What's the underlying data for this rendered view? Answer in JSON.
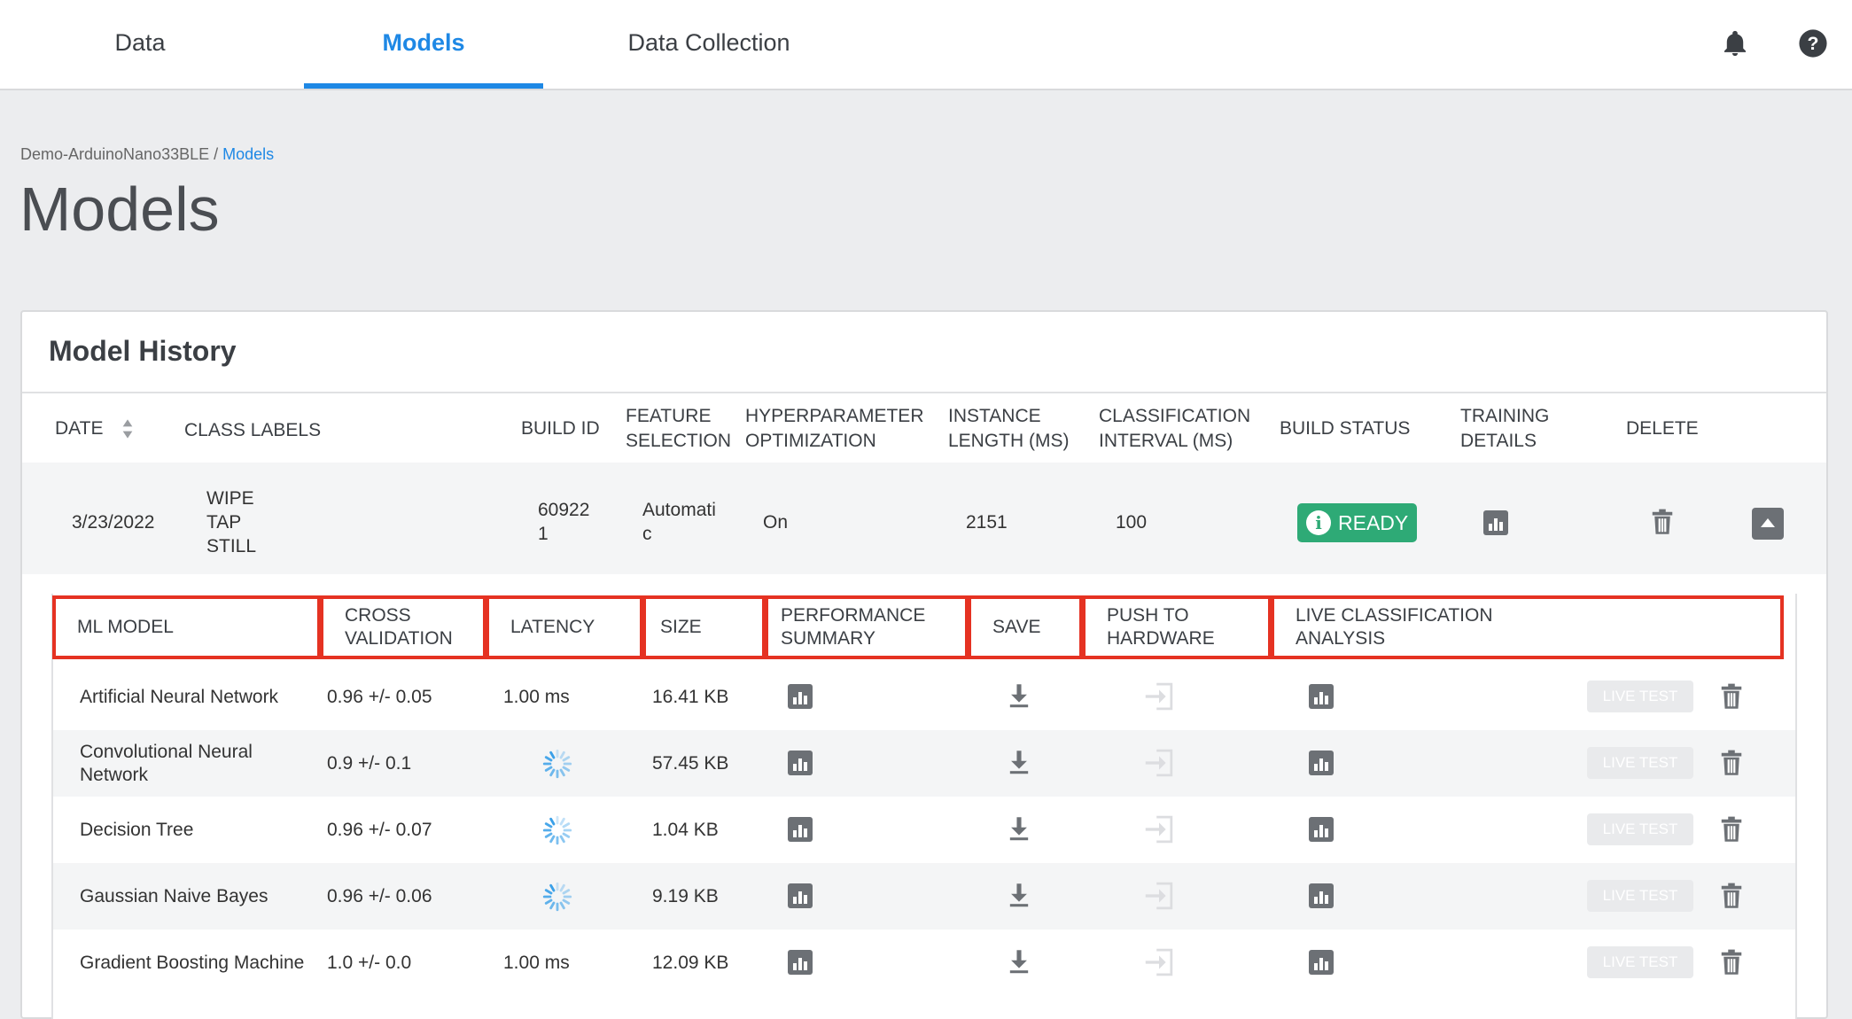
{
  "nav": {
    "tabs": [
      {
        "label": "Data"
      },
      {
        "label": "Models"
      },
      {
        "label": "Data Collection"
      }
    ],
    "active_tab": "Models",
    "icons": [
      "bell-icon",
      "help-icon"
    ]
  },
  "breadcrumb": {
    "project": "Demo-ArduinoNano33BLE",
    "separator": " / ",
    "current": "Models"
  },
  "page_title": "Models",
  "model_history": {
    "title": "Model History",
    "headers": {
      "date": "DATE",
      "class_labels": "CLASS LABELS",
      "build_id": "BUILD ID",
      "feature_selection_1": "FEATURE",
      "feature_selection_2": "SELECTION",
      "hyperparameter_1": "HYPERPARAMETER",
      "hyperparameter_2": "OPTIMIZATION",
      "instance_length_1": "INSTANCE",
      "instance_length_2": "LENGTH (MS)",
      "classification_interval_1": "CLASSIFICATION",
      "classification_interval_2": "INTERVAL (MS)",
      "build_status": "BUILD STATUS",
      "training_details_1": "TRAINING",
      "training_details_2": "DETAILS",
      "delete": "DELETE"
    },
    "build": {
      "date": "3/23/2022",
      "labels": [
        "WIPE",
        "TAP",
        "STILL"
      ],
      "build_id_1": "60922",
      "build_id_2": "1",
      "feature_selection_1": "Automati",
      "feature_selection_2": "c",
      "hyperparameter_optimization": "On",
      "instance_length": "2151",
      "classification_interval": "100",
      "status": "READY",
      "status_color": "#2eaa76"
    },
    "sub_headers": {
      "ml_model": "ML MODEL",
      "cross_validation_1": "CROSS",
      "cross_validation_2": "VALIDATION",
      "latency": "LATENCY",
      "size": "SIZE",
      "performance_1": "PERFORMANCE",
      "performance_2": "SUMMARY",
      "save": "SAVE",
      "push_1": "PUSH TO",
      "push_2": "HARDWARE",
      "live_1": "LIVE CLASSIFICATION",
      "live_2": "ANALYSIS"
    },
    "live_test_label": "LIVE TEST",
    "models": [
      {
        "name_1": "Artificial Neural Network",
        "name_2": "",
        "cv": "0.96 +/- 0.05",
        "latency": "1.00 ms",
        "loading": false,
        "size": "16.41 KB"
      },
      {
        "name_1": "Convolutional Neural",
        "name_2": "Network",
        "cv": "0.9 +/- 0.1",
        "latency": "",
        "loading": true,
        "size": "57.45 KB"
      },
      {
        "name_1": "Decision Tree",
        "name_2": "",
        "cv": "0.96 +/- 0.07",
        "latency": "",
        "loading": true,
        "size": "1.04 KB"
      },
      {
        "name_1": "Gaussian Naive Bayes",
        "name_2": "",
        "cv": "0.96 +/- 0.06",
        "latency": "",
        "loading": true,
        "size": "9.19 KB"
      },
      {
        "name_1": "Gradient Boosting Machine",
        "name_2": "",
        "cv": "1.0 +/- 0.0",
        "latency": "1.00 ms",
        "loading": false,
        "size": "12.09 KB"
      }
    ],
    "accent_color": "#1e88e5",
    "highlight_color": "#e53222"
  }
}
